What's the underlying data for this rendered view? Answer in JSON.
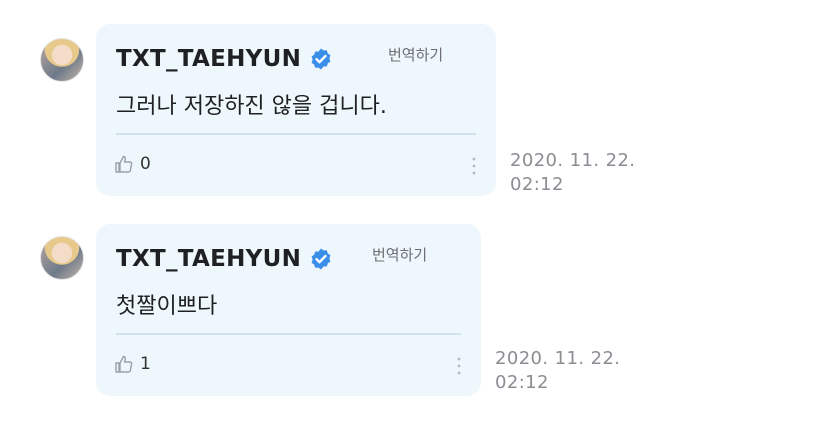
{
  "comments": [
    {
      "author": "TXT_TAEHYUN",
      "verified": true,
      "translate_label": "번역하기",
      "text": "그러나 저장하진 않을 겁니다.",
      "likes": "0",
      "timestamp_date": "2020. 11. 22.",
      "timestamp_time": "02:12"
    },
    {
      "author": "TXT_TAEHYUN",
      "verified": true,
      "translate_label": "번역하기",
      "text": "첫짤이쁘다",
      "likes": "1",
      "timestamp_date": "2020. 11. 22.",
      "timestamp_time": "02:12"
    }
  ],
  "icons": {
    "verified": "verified-badge-icon",
    "like": "thumbs-up-icon",
    "more": "more-vertical-icon"
  },
  "colors": {
    "bubble_bg": "#eef7fc",
    "verified_blue": "#3b8fe8",
    "divider": "#cfe3ee"
  }
}
